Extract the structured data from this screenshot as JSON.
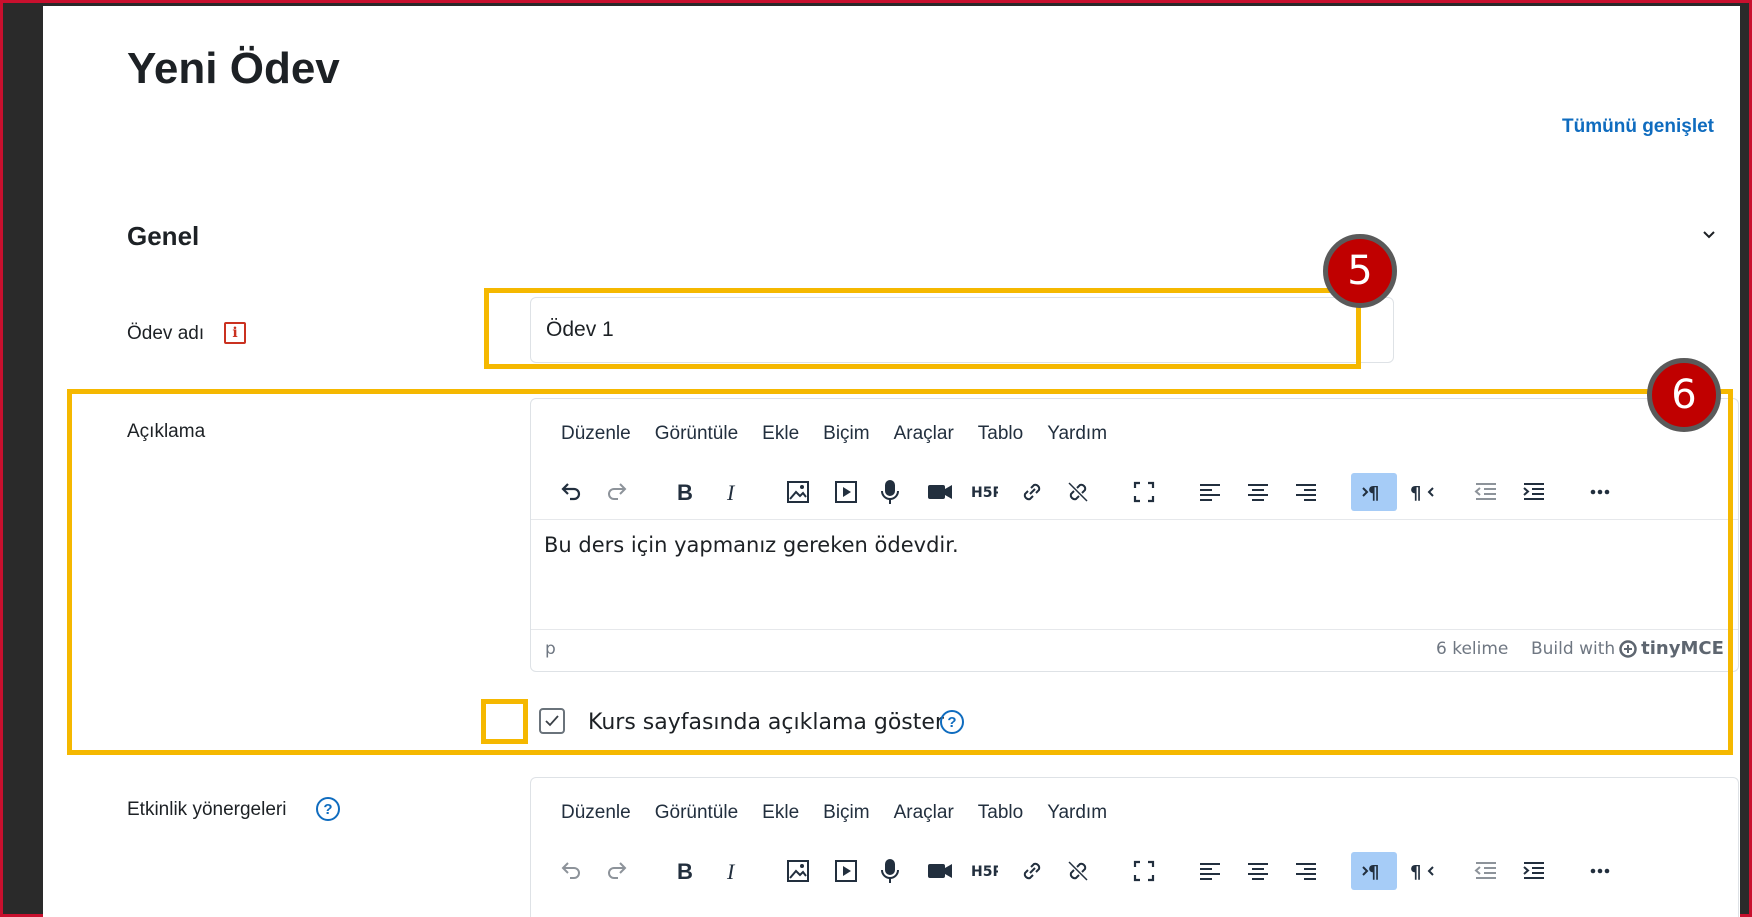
{
  "page": {
    "title": "Yeni Ödev",
    "expand_all": "Tümünü genişlet"
  },
  "section": {
    "title": "Genel"
  },
  "fields": {
    "name_label": "Ödev adı",
    "name_value": "Ödev 1",
    "description_label": "Açıklama",
    "instructions_label": "Etkinlik yönergeleri"
  },
  "editor": {
    "menu": [
      "Düzenle",
      "Görüntüle",
      "Ekle",
      "Biçim",
      "Araçlar",
      "Tablo",
      "Yardım"
    ],
    "content": "Bu ders için yapmanız gereken ödevdir.",
    "status_path": "p",
    "word_count": "6 kelime",
    "build_with": "Build with",
    "brand": "tinyMCE"
  },
  "checkbox": {
    "label": "Kurs sayfasında açıklama göster",
    "checked": true
  },
  "markers": {
    "m5": "5",
    "m6": "6"
  },
  "colors": {
    "highlight": "#f5b800",
    "marker": "#c00000",
    "link": "#0f6cbf",
    "required": "#ca3120",
    "active_button": "#a6ccf7"
  }
}
